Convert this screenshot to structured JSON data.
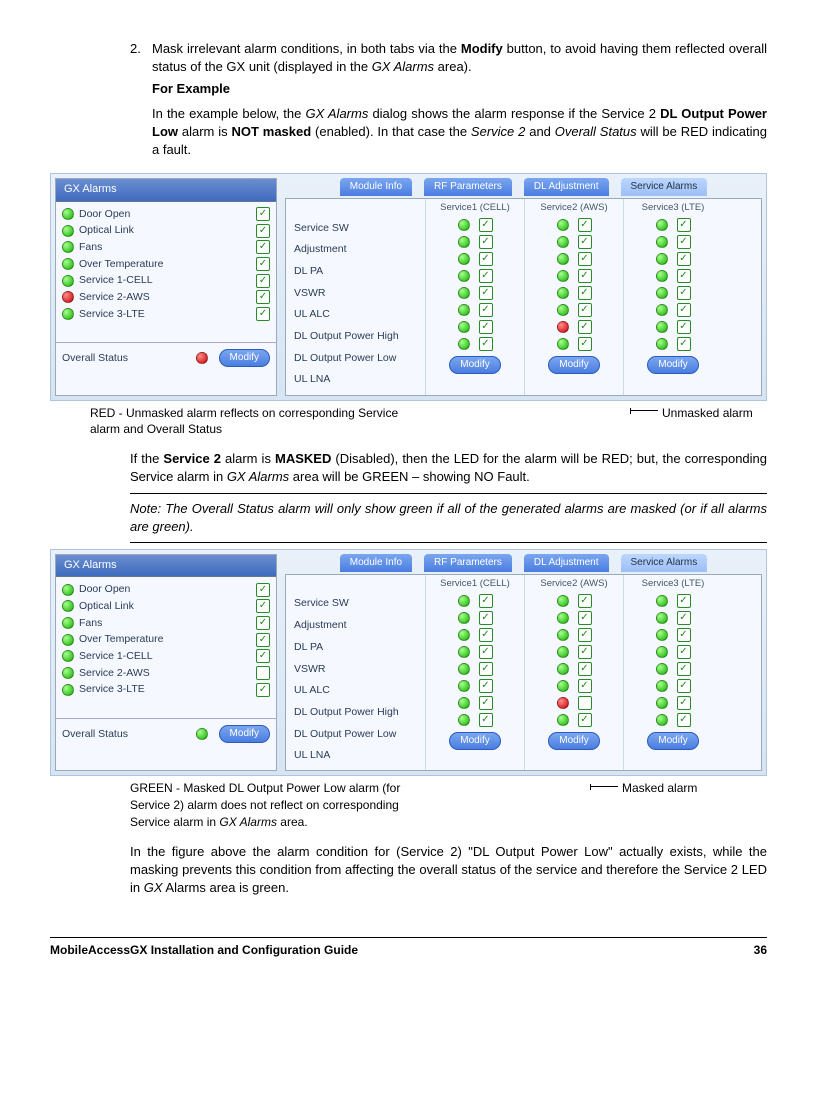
{
  "list_number": "2.",
  "list_text_a": "Mask irrelevant alarm conditions, in both tabs via the ",
  "list_text_b": " button, to avoid having them reflected overall status of the GX unit (displayed in the ",
  "list_text_c": " area).",
  "modify_word": "Modify",
  "gx_alarms_italic": "GX Alarms",
  "for_example": "For Example",
  "ex_a": "In the example below, the ",
  "ex_b": " dialog shows the alarm response if the Service 2 ",
  "ex_c": " alarm is ",
  "ex_d": " (enabled). In that case the ",
  "ex_e": " and ",
  "ex_f": " will be RED indicating a fault.",
  "dl_output": "DL Output Power Low",
  "not_masked": "NOT masked",
  "service2_i": "Service 2",
  "overall_i": "Overall Status",
  "panel_title": "GX Alarms",
  "alarms_left": [
    "Door Open",
    "Optical Link",
    "Fans",
    "Over Temperature",
    "Service 1-CELL",
    "Service 2-AWS",
    "Service 3-LTE"
  ],
  "overall_label": "Overall Status",
  "modify_btn": "Modify",
  "tabs": [
    "Module Info",
    "RF Parameters",
    "DL Adjustment",
    "Service Alarms"
  ],
  "svc_labels": [
    "Service SW",
    "Adjustment",
    "DL PA",
    "VSWR",
    "UL ALC",
    "DL Output Power High",
    "DL Output Power Low",
    "UL LNA"
  ],
  "svc_heads": [
    "Service1 (CELL)",
    "Service2 (AWS)",
    "Service3 (LTE)"
  ],
  "annot1_left": "RED - Unmasked alarm reflects on corresponding Service alarm and Overall Status",
  "annot1_right": "Unmasked alarm",
  "mid_a": "If the ",
  "mid_b": " alarm is ",
  "mid_c": " (Disabled), then the LED for the alarm will be RED; but, the corresponding Service alarm in ",
  "mid_d": " area will be GREEN – showing NO Fault.",
  "service2_b": "Service 2",
  "masked_b": "MASKED",
  "note": "Note: The Overall Status alarm will only show green if all of the generated alarms are masked (or if all alarms are green).",
  "annot2_left_a": "GREEN - Masked DL Output Power Low alarm (for Service 2) alarm does not reflect on corresponding Service alarm in ",
  "annot2_left_b": " area.",
  "annot2_right": "Masked alarm",
  "final_a": "In the figure above the alarm condition for (Service 2) \"DL Output Power Low\" actually exists, while the masking prevents this condition from affecting the overall status of the service and therefore the Service 2 LED in ",
  "final_b": " Alarms area is green.",
  "gx_i": "GX",
  "footer_title": "MobileAccessGX Installation and Configuration Guide",
  "page_num": "36"
}
